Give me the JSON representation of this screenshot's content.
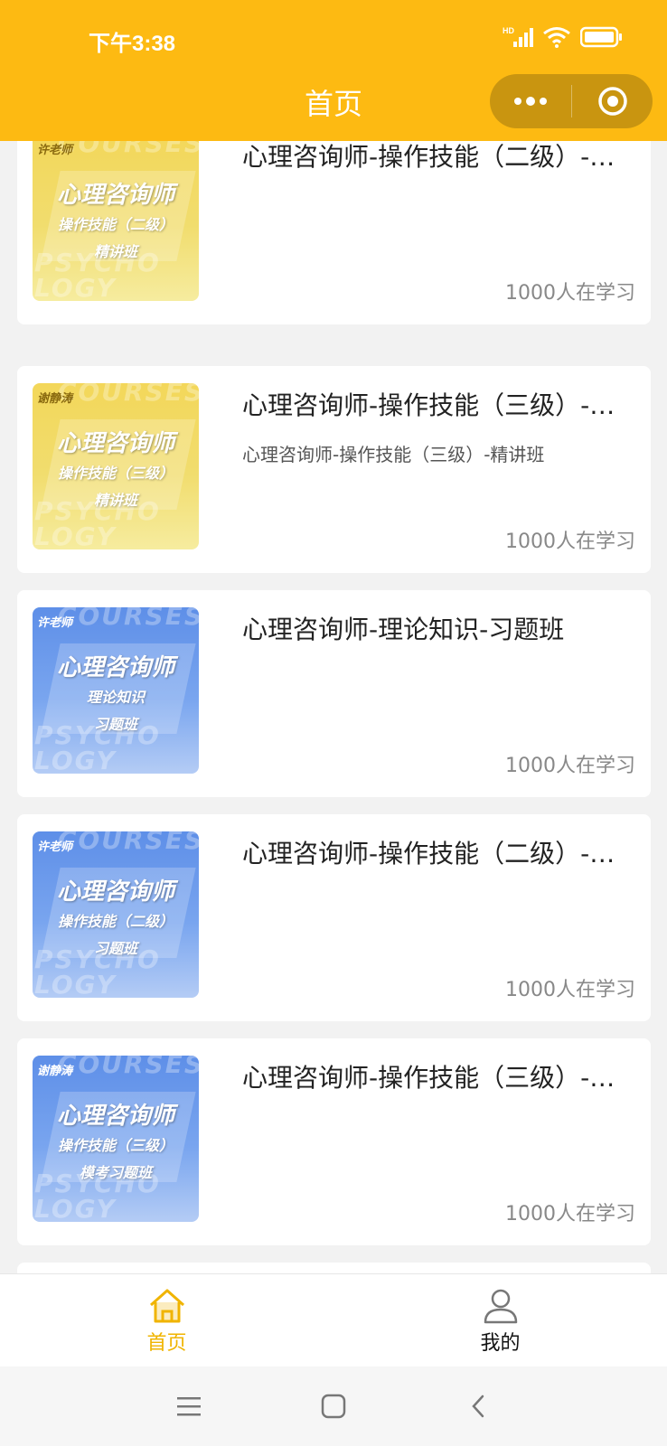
{
  "status_bar": {
    "time": "下午3:38",
    "network": "HD"
  },
  "nav": {
    "title": "首页"
  },
  "colors": {
    "brand": "#fdba12",
    "active_tab": "#f0b400"
  },
  "courses": [
    {
      "teacher": "许老师",
      "cover_line1": "心理咨询师",
      "cover_line2": "操作技能（二级）",
      "cover_line3": "精讲班",
      "cover_color": "yellow",
      "title": "心理咨询师-操作技能（二级）-精讲班",
      "subtitle": "",
      "learners": "1000人在学习"
    },
    {
      "teacher": "谢静涛",
      "cover_line1": "心理咨询师",
      "cover_line2": "操作技能（三级）",
      "cover_line3": "精讲班",
      "cover_color": "yellow",
      "title": "心理咨询师-操作技能（三级）-精讲班",
      "subtitle": "心理咨询师-操作技能（三级）-精讲班",
      "learners": "1000人在学习"
    },
    {
      "teacher": "许老师",
      "cover_line1": "心理咨询师",
      "cover_line2": "理论知识",
      "cover_line3": "习题班",
      "cover_color": "blue",
      "title": "心理咨询师-理论知识-习题班",
      "subtitle": "",
      "learners": "1000人在学习"
    },
    {
      "teacher": "许老师",
      "cover_line1": "心理咨询师",
      "cover_line2": "操作技能（二级）",
      "cover_line3": "习题班",
      "cover_color": "blue",
      "title": "心理咨询师-操作技能（二级）-习题班",
      "subtitle": "",
      "learners": "1000人在学习"
    },
    {
      "teacher": "谢静涛",
      "cover_line1": "心理咨询师",
      "cover_line2": "操作技能（三级）",
      "cover_line3": "模考习题班",
      "cover_color": "blue",
      "title": "心理咨询师-操作技能（三级）-模考习题班",
      "subtitle": "",
      "learners": "1000人在学习"
    }
  ],
  "cover_watermark": {
    "top": "COURSES",
    "mid": "PSYCHO",
    "bottom": "LOGY"
  },
  "tabbar": [
    {
      "label": "首页",
      "icon": "home-icon",
      "active": true
    },
    {
      "label": "我的",
      "icon": "user-icon",
      "active": false
    }
  ],
  "system_nav": {
    "buttons": [
      "menu-icon",
      "home-square-icon",
      "back-icon"
    ]
  }
}
